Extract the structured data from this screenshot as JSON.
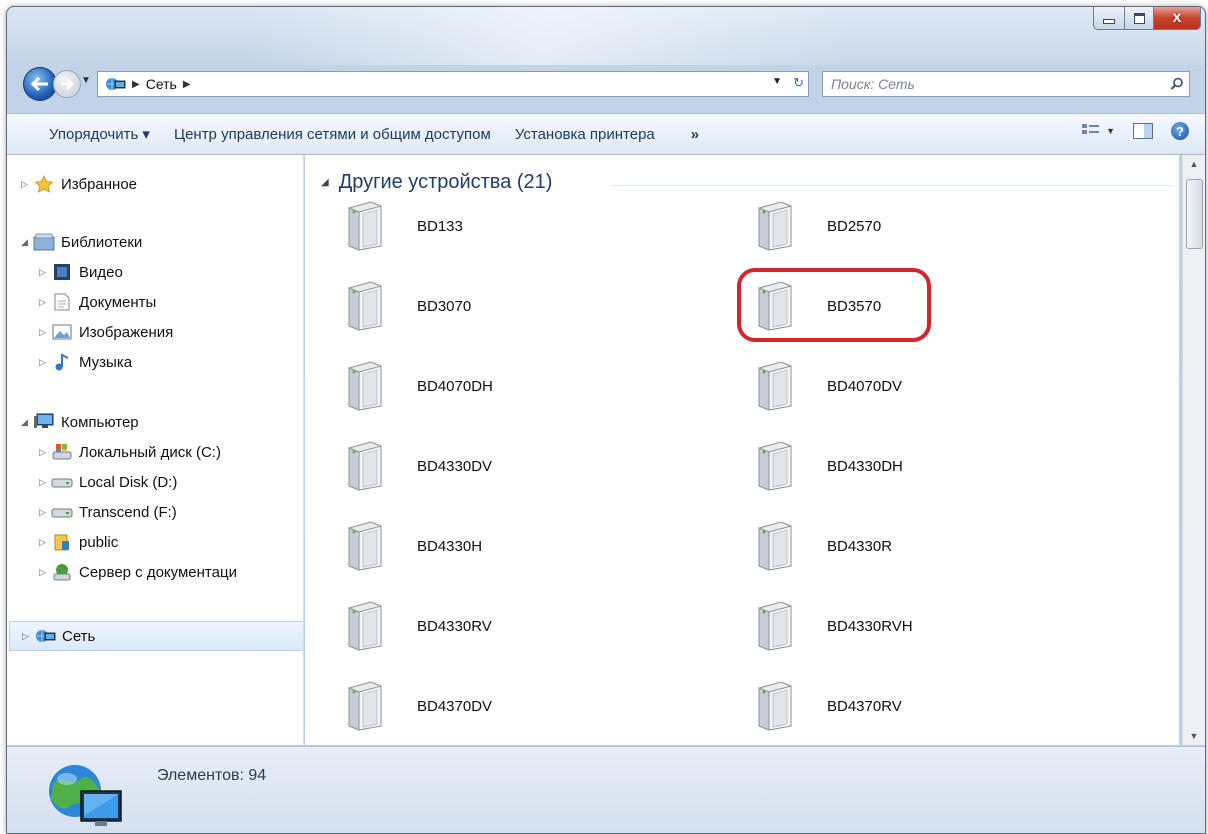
{
  "window": {
    "caption": {
      "minimize": "",
      "maximize": "",
      "close": "x"
    }
  },
  "address_bar": {
    "path": [
      "Сеть"
    ],
    "search_placeholder": "Поиск: Сеть"
  },
  "toolbar": {
    "organize_label": "Упорядочить ▾",
    "network_center_label": "Центр управления сетями и общим доступом",
    "add_printer_label": "Установка принтера",
    "more_label": "»"
  },
  "sidebar": {
    "favorites": "Избранное",
    "libraries": "Библиотеки",
    "library_items": [
      "Видео",
      "Документы",
      "Изображения",
      "Музыка"
    ],
    "computer": "Компьютер",
    "computer_items": [
      "Локальный диск (C:)",
      "Local Disk (D:)",
      "Transcend (F:)",
      "public",
      "Сервер с документаци"
    ],
    "network": "Сеть"
  },
  "content": {
    "group_title": "Другие устройства (21)",
    "devices": [
      "BD133",
      "BD2570",
      "BD3070",
      "BD3570",
      "BD4070DH",
      "BD4070DV",
      "BD4330DV",
      "BD4330DH",
      "BD4330H",
      "BD4330R",
      "BD4330RV",
      "BD4330RVH",
      "BD4370DV",
      "BD4370RV"
    ],
    "highlighted_device": "BD3570"
  },
  "status_bar": {
    "items_count": "Элементов: 94"
  },
  "colors": {
    "highlight": "#d1262e",
    "accent": "#1e395b"
  }
}
